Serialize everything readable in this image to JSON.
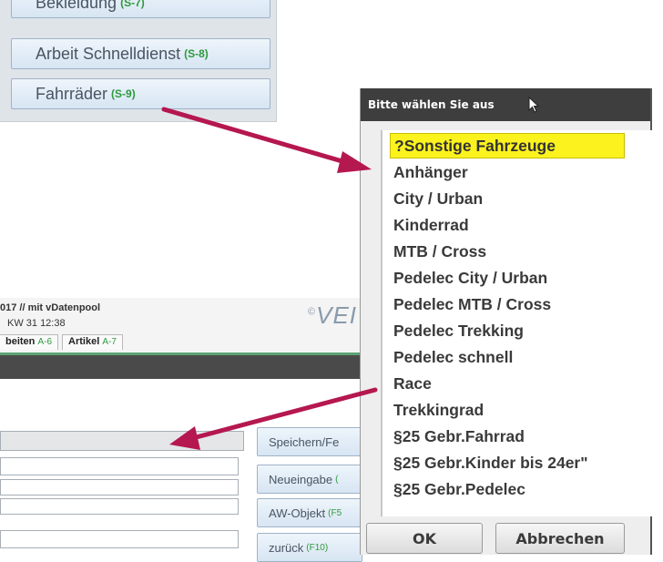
{
  "category_panel": {
    "items": [
      {
        "label": "Bekleidung",
        "code": "(S-7)"
      },
      {
        "label": "Arbeit Schnelldienst",
        "code": "(S-8)"
      },
      {
        "label": "Fahrräder",
        "code": "(S-9)"
      }
    ]
  },
  "app": {
    "title": "017 // mit vDatenpool",
    "week": "KW 31  12:38",
    "logo": "VEI",
    "logo_mark": "©",
    "tabs": [
      {
        "label": "beiten",
        "code": "A-6"
      },
      {
        "label": "Artikel",
        "code": "A-7"
      }
    ],
    "buttons": [
      {
        "label": "Speichern/Fe",
        "code": ""
      },
      {
        "label": "Neueingabe",
        "code": "("
      },
      {
        "label": "AW-Objekt",
        "code": "(F5"
      },
      {
        "label": "zurück",
        "code": "(F10)"
      }
    ]
  },
  "dialog": {
    "title": "Bitte wählen Sie aus",
    "items": [
      "?Sonstige Fahrzeuge",
      "Anhänger",
      "City / Urban",
      "Kinderrad",
      "MTB / Cross",
      "Pedelec City / Urban",
      "Pedelec MTB / Cross",
      "Pedelec Trekking",
      "Pedelec schnell",
      "Race",
      "Trekkingrad",
      "§25 Gebr.Fahrrad",
      "§25 Gebr.Kinder bis 24er\"",
      "§25 Gebr.Pedelec"
    ],
    "selected_item": "?Sonstige Fahrzeuge",
    "ok_label": "OK",
    "cancel_label": "Abbrechen"
  },
  "colors": {
    "arrow": "#b5174f",
    "highlight": "#fcf21e",
    "code_green": "#2c9a3c",
    "title_bar": "#3e3e3e"
  }
}
